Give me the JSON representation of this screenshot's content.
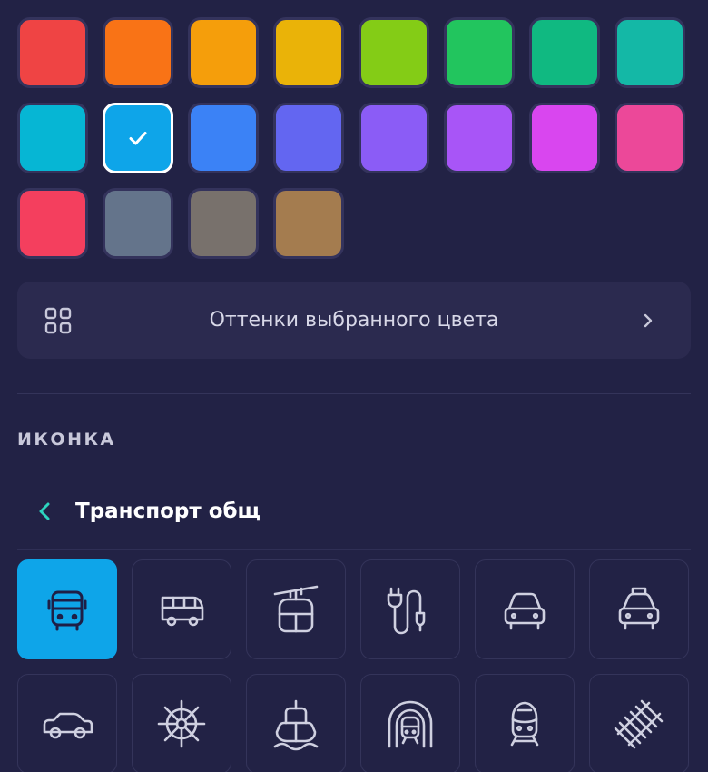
{
  "colors": {
    "swatches": [
      {
        "name": "red",
        "hex": "#ef4444"
      },
      {
        "name": "orange",
        "hex": "#f97316"
      },
      {
        "name": "amber",
        "hex": "#f59e0b"
      },
      {
        "name": "yellow",
        "hex": "#eab308"
      },
      {
        "name": "lime",
        "hex": "#84cc16"
      },
      {
        "name": "green",
        "hex": "#22c55e"
      },
      {
        "name": "emerald",
        "hex": "#10b981"
      },
      {
        "name": "teal",
        "hex": "#14b8a6"
      },
      {
        "name": "cyan",
        "hex": "#06b6d4"
      },
      {
        "name": "sky",
        "hex": "#0ea5e9"
      },
      {
        "name": "blue",
        "hex": "#3b82f6"
      },
      {
        "name": "indigo",
        "hex": "#6366f1"
      },
      {
        "name": "violet",
        "hex": "#8b5cf6"
      },
      {
        "name": "purple",
        "hex": "#a855f7"
      },
      {
        "name": "fuchsia",
        "hex": "#d946ef"
      },
      {
        "name": "pink",
        "hex": "#ec4899"
      },
      {
        "name": "rose",
        "hex": "#f43f5e"
      },
      {
        "name": "slate",
        "hex": "#64748b"
      },
      {
        "name": "stone",
        "hex": "#78716c"
      },
      {
        "name": "brown",
        "hex": "#a47c4f"
      }
    ],
    "selected_index": 9,
    "shades_label": "Оттенки выбранного цвета"
  },
  "icon_section": {
    "title": "ИКОНКА",
    "category": "Транспорт общ",
    "selected_index": 0,
    "icons": [
      "bus-front-icon",
      "bus-side-icon",
      "cable-car-icon",
      "ev-charger-icon",
      "car-front-icon",
      "taxi-icon",
      "car-side-icon",
      "ship-wheel-icon",
      "ship-icon",
      "tunnel-train-icon",
      "train-front-icon",
      "railway-track-icon"
    ]
  },
  "theme": {
    "background": "#222245",
    "card": "#2b2a4f",
    "accent": "#0ea5e9",
    "back_arrow": "#2dd4bf"
  }
}
